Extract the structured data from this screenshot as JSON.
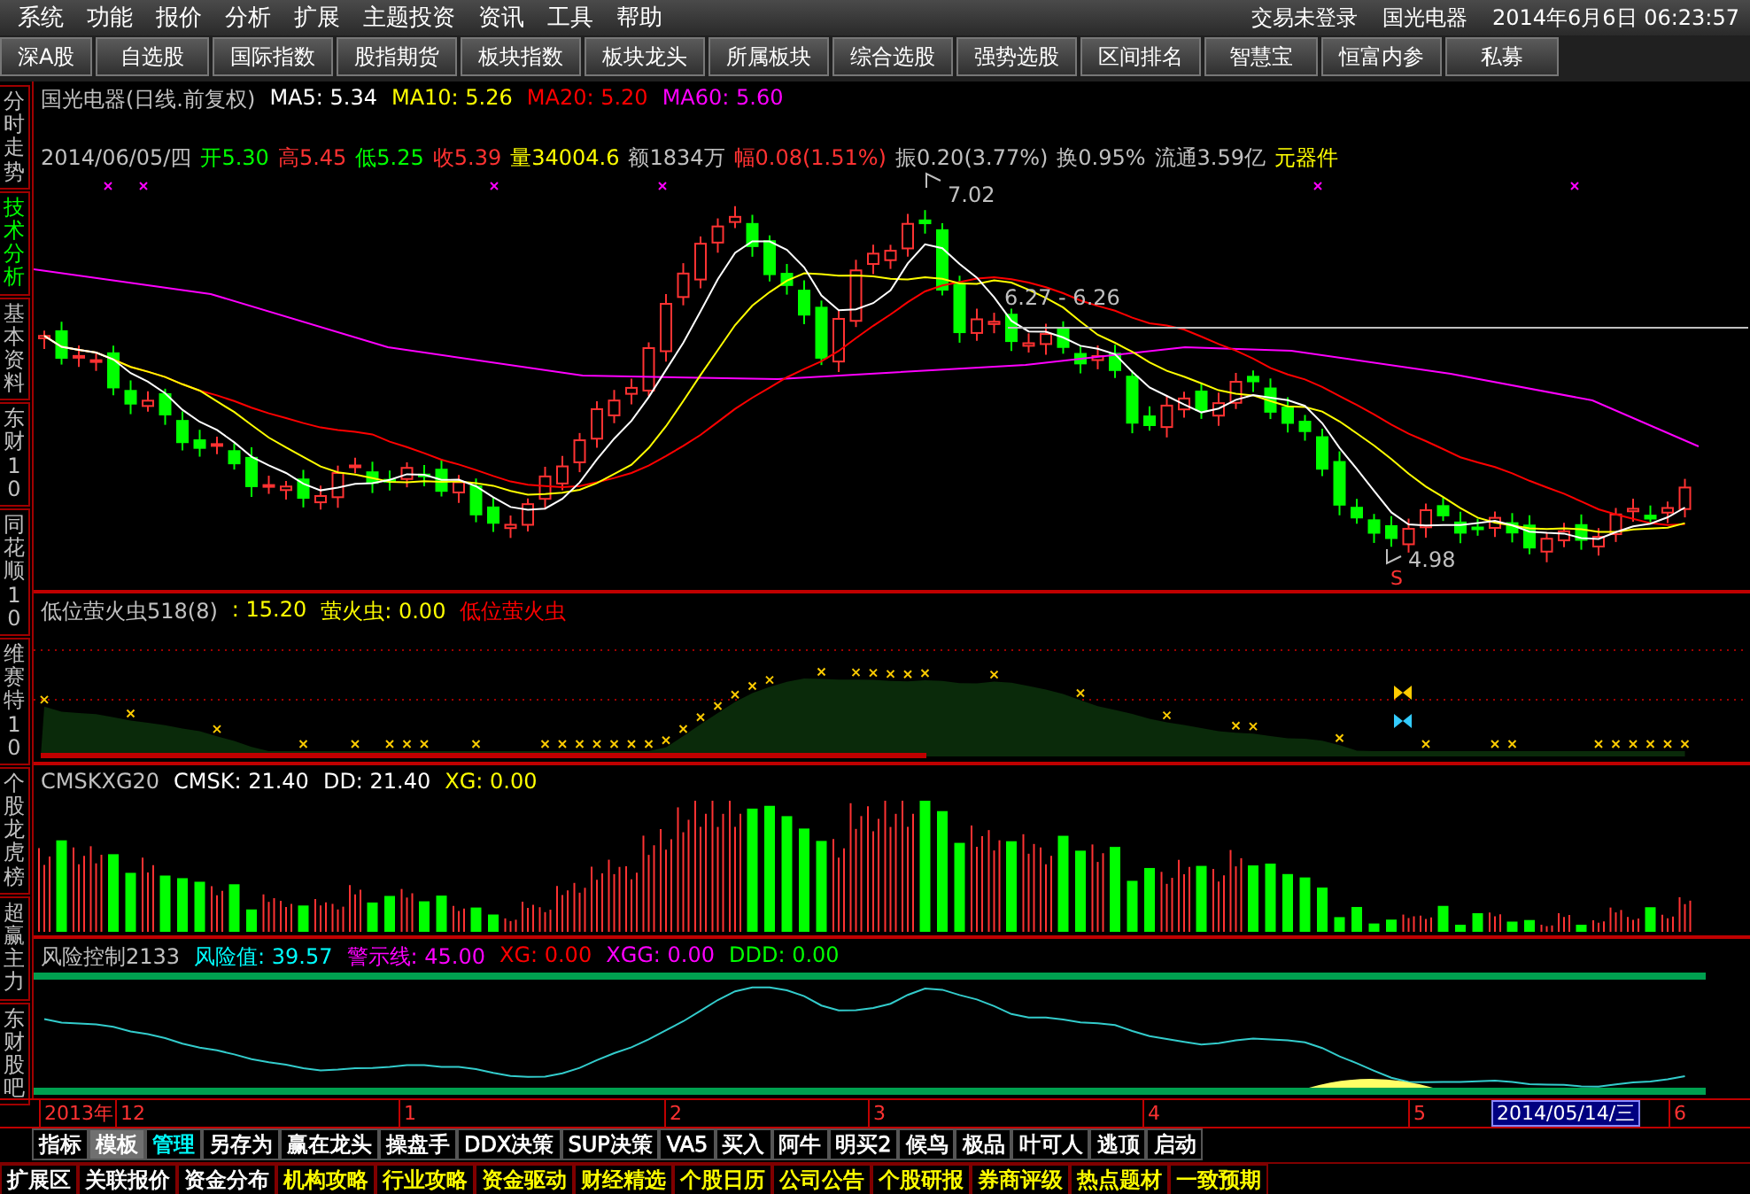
{
  "menu": [
    "系统",
    "功能",
    "报价",
    "分析",
    "扩展",
    "主题投资",
    "资讯",
    "工具",
    "帮助"
  ],
  "status": {
    "login": "交易未登录",
    "stock": "国光电器",
    "datetime": "2014年6月6日  06:23:57"
  },
  "toolbar": [
    "深A股",
    "自选股",
    "国际指数",
    "股指期货",
    "板块指数",
    "板块龙头",
    "所属板块",
    "综合选股",
    "强势选股",
    "区间排名",
    "智慧宝",
    "恒富内参",
    "私募"
  ],
  "side_tabs": [
    {
      "label": "分时走势",
      "selected": false
    },
    {
      "label": "技术分析",
      "selected": true
    },
    {
      "label": "基本资料",
      "selected": false
    },
    {
      "label": "东财10",
      "selected": false
    },
    {
      "label": "同花顺10",
      "selected": false
    },
    {
      "label": "维赛特10",
      "selected": false
    },
    {
      "label": "个股龙虎榜",
      "selected": false
    },
    {
      "label": "超赢主力",
      "selected": false
    },
    {
      "label": "东财股吧",
      "selected": false
    }
  ],
  "main_chart": {
    "legend": [
      {
        "text": "国光电器(日线.前复权)",
        "color": "#c0c0c0"
      },
      {
        "text": "MA5: 5.34",
        "color": "#ffffff"
      },
      {
        "text": "MA10: 5.26",
        "color": "#ffff00"
      },
      {
        "text": "MA20: 5.20",
        "color": "#ff0000"
      },
      {
        "text": "MA60: 5.60",
        "color": "#ff00ff"
      }
    ],
    "info": [
      {
        "text": "2014/06/05/四",
        "color": "#c0c0c0"
      },
      {
        "text": "开5.30",
        "color": "#00ff00"
      },
      {
        "text": "高5.45",
        "color": "#ff3232"
      },
      {
        "text": "低5.25",
        "color": "#00ff00"
      },
      {
        "text": "收5.39",
        "color": "#ff3232"
      },
      {
        "text": "量34004.6",
        "color": "#ffff00"
      },
      {
        "text": "额1834万",
        "color": "#c0c0c0"
      },
      {
        "text": "幅0.08(1.51%)",
        "color": "#ff3232"
      },
      {
        "text": "振0.20(3.77%)",
        "color": "#c0c0c0"
      },
      {
        "text": "换0.95%",
        "color": "#c0c0c0"
      },
      {
        "text": "流通3.59亿",
        "color": "#c0c0c0"
      },
      {
        "text": "元器件",
        "color": "#ffff00"
      }
    ],
    "high_label": "7.02",
    "range_label": "6.27 - 6.26",
    "low_label": "4.98",
    "signal": "S"
  },
  "indicators": [
    {
      "legend": [
        {
          "text": "低位萤火虫518(8)",
          "color": "#c0c0c0"
        },
        {
          "text": ": 15.20",
          "color": "#ffff00"
        },
        {
          "text": "萤火虫: 0.00",
          "color": "#ffff00"
        },
        {
          "text": "低位萤火虫",
          "color": "#ff0000"
        }
      ]
    },
    {
      "legend": [
        {
          "text": "CMSKXG20",
          "color": "#c0c0c0"
        },
        {
          "text": "CMSK: 21.40",
          "color": "#ffffff"
        },
        {
          "text": "DD: 21.40",
          "color": "#ffffff"
        },
        {
          "text": "XG: 0.00",
          "color": "#ffff00"
        }
      ]
    },
    {
      "legend": [
        {
          "text": "风险控制2133",
          "color": "#c0c0c0"
        },
        {
          "text": "风险值: 39.57",
          "color": "#00ffff"
        },
        {
          "text": "警示线: 45.00",
          "color": "#ff00ff"
        },
        {
          "text": "XG: 0.00",
          "color": "#ff0000"
        },
        {
          "text": "XGG: 0.00",
          "color": "#ff00ff"
        },
        {
          "text": "DDD: 0.00",
          "color": "#00ff00"
        }
      ]
    }
  ],
  "date_axis": {
    "labels": [
      "2013年",
      "12",
      "1",
      "2",
      "3",
      "4",
      "5",
      "6"
    ],
    "cursor_date": "2014/05/14/三"
  },
  "function_tabs": [
    {
      "label": "指标",
      "selected": false,
      "highlighted": false
    },
    {
      "label": "模板",
      "selected": true,
      "highlighted": false
    },
    {
      "label": "管理",
      "selected": false,
      "highlighted": true
    },
    {
      "label": "另存为",
      "selected": false,
      "highlighted": false
    },
    {
      "label": "赢在龙头",
      "selected": false,
      "highlighted": false
    },
    {
      "label": "操盘手",
      "selected": false,
      "highlighted": false
    },
    {
      "label": "DDX决策",
      "selected": false,
      "highlighted": false
    },
    {
      "label": "SUP决策",
      "selected": false,
      "highlighted": false
    },
    {
      "label": "VA5",
      "selected": false,
      "highlighted": false
    },
    {
      "label": "买入",
      "selected": false,
      "highlighted": false
    },
    {
      "label": "阿牛",
      "selected": false,
      "highlighted": false
    },
    {
      "label": "明买2",
      "selected": false,
      "highlighted": false
    },
    {
      "label": "候鸟",
      "selected": false,
      "highlighted": false
    },
    {
      "label": "极品",
      "selected": false,
      "highlighted": false
    },
    {
      "label": "叶可人",
      "selected": false,
      "highlighted": false
    },
    {
      "label": "逃顶",
      "selected": false,
      "highlighted": false
    },
    {
      "label": "启动",
      "selected": false,
      "highlighted": false
    }
  ],
  "info_tabs": [
    {
      "label": "扩展区",
      "highlighted": false
    },
    {
      "label": "关联报价",
      "highlighted": false
    },
    {
      "label": "资金分布",
      "highlighted": false
    },
    {
      "label": "机构攻略",
      "highlighted": true
    },
    {
      "label": "行业攻略",
      "highlighted": true
    },
    {
      "label": "资金驱动",
      "highlighted": true
    },
    {
      "label": "财经精选",
      "highlighted": true
    },
    {
      "label": "个股日历",
      "highlighted": true
    },
    {
      "label": "公司公告",
      "highlighted": true
    },
    {
      "label": "个股研报",
      "highlighted": true
    },
    {
      "label": "券商评级",
      "highlighted": true
    },
    {
      "label": "热点题材",
      "highlighted": true
    },
    {
      "label": "一致预期",
      "highlighted": true
    }
  ]
}
